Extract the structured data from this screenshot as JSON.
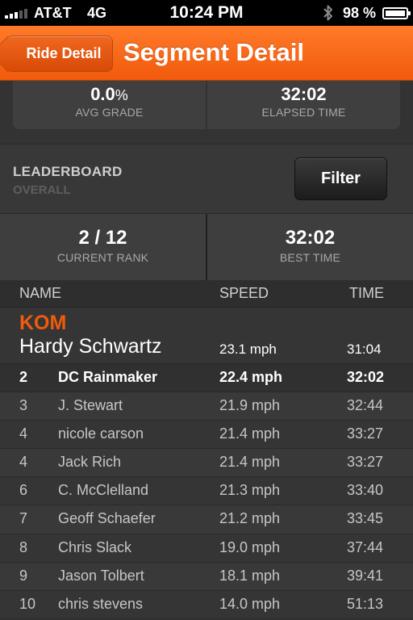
{
  "status_bar": {
    "carrier": "AT&T",
    "network": "4G",
    "time": "10:24 PM",
    "battery": "98 %"
  },
  "nav": {
    "back_label": "Ride Detail",
    "title": "Segment Detail"
  },
  "stats": {
    "avg_grade_value": "0.0",
    "avg_grade_unit": "%",
    "avg_grade_label": "AVG GRADE",
    "elapsed_value": "32:02",
    "elapsed_label": "ELAPSED TIME"
  },
  "leaderboard": {
    "title": "LEADERBOARD",
    "subtitle": "OVERALL",
    "filter_label": "Filter",
    "rank_value": "2 / 12",
    "rank_label": "CURRENT RANK",
    "best_value": "32:02",
    "best_label": "BEST TIME"
  },
  "table": {
    "headers": {
      "name": "NAME",
      "speed": "SPEED",
      "time": "TIME"
    },
    "kom": {
      "label": "KOM",
      "name": "Hardy Schwartz",
      "speed": "23.1 mph",
      "time": "31:04"
    },
    "rows": [
      {
        "rank": "2",
        "name": "DC Rainmaker",
        "speed": "22.4 mph",
        "time": "32:02"
      },
      {
        "rank": "3",
        "name": "J. Stewart",
        "speed": "21.9 mph",
        "time": "32:44"
      },
      {
        "rank": "4",
        "name": "nicole carson",
        "speed": "21.4 mph",
        "time": "33:27"
      },
      {
        "rank": "4",
        "name": "Jack Rich",
        "speed": "21.4 mph",
        "time": "33:27"
      },
      {
        "rank": "6",
        "name": "C. McClelland",
        "speed": "21.3 mph",
        "time": "33:40"
      },
      {
        "rank": "7",
        "name": "Geoff Schaefer",
        "speed": "21.2 mph",
        "time": "33:45"
      },
      {
        "rank": "8",
        "name": "Chris Slack",
        "speed": "19.0 mph",
        "time": "37:44"
      },
      {
        "rank": "9",
        "name": "Jason Tolbert",
        "speed": "18.1 mph",
        "time": "39:41"
      },
      {
        "rank": "10",
        "name": "chris stevens",
        "speed": "14.0 mph",
        "time": "51:13"
      }
    ]
  },
  "colors": {
    "accent": "#f25a0c",
    "background": "#333333"
  }
}
